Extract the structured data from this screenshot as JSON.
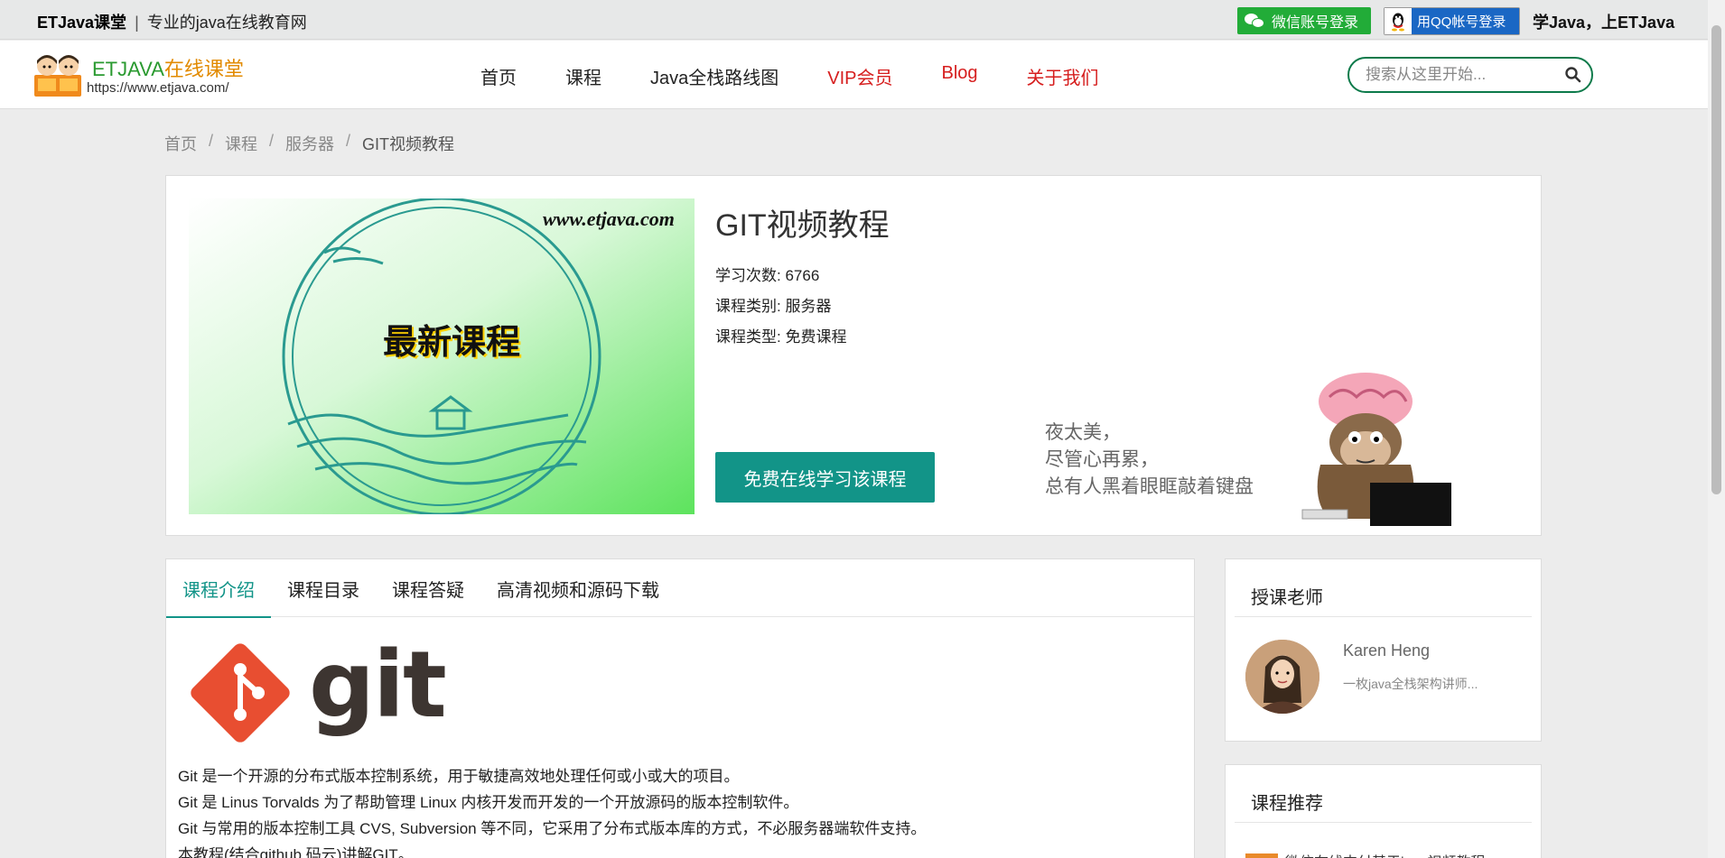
{
  "topbar": {
    "site_name": "ETJava课堂",
    "separator": "|",
    "tagline": "专业的java在线教育网",
    "wechat_login": "微信账号登录",
    "qq_login": "用QQ帐号登录",
    "slogan": "学Java，上ETJava"
  },
  "logo": {
    "brand_en": "ETJAVA",
    "brand_cn": "在线课堂",
    "url": "https://www.etjava.com/"
  },
  "nav": [
    {
      "label": "首页",
      "color": "#222222"
    },
    {
      "label": "课程",
      "color": "#222222"
    },
    {
      "label": "Java全栈路线图",
      "color": "#222222"
    },
    {
      "label": "VIP会员",
      "color": "#d61e1e"
    },
    {
      "label": "Blog",
      "color": "#d61e1e"
    },
    {
      "label": "关于我们",
      "color": "#d61e1e"
    }
  ],
  "search": {
    "placeholder": "搜索从这里开始..."
  },
  "breadcrumb": {
    "items": [
      "首页",
      "课程",
      "服务器"
    ],
    "current": "GIT视频教程",
    "divider": "/"
  },
  "course": {
    "cover_url_text": "www.etjava.com",
    "cover_badge": "最新课程",
    "title": "GIT视频教程",
    "study_count_label": "学习次数:",
    "study_count": "6766",
    "category_label": "课程类别:",
    "category": "服务器",
    "type_label": "课程类型:",
    "type": "免费课程",
    "study_button": "免费在线学习该课程",
    "poem_lines": [
      "夜太美，",
      "尽管心再累，",
      "总有人黑着眼眶敲着键盘"
    ]
  },
  "tabs": [
    {
      "label": "课程介绍",
      "active": true
    },
    {
      "label": "课程目录",
      "active": false
    },
    {
      "label": "课程答疑",
      "active": false
    },
    {
      "label": "高清视频和源码下载",
      "active": false
    }
  ],
  "intro": {
    "logo_text": "git",
    "paragraphs": [
      "Git 是一个开源的分布式版本控制系统，用于敏捷高效地处理任何或小或大的项目。",
      "Git 是 Linus Torvalds 为了帮助管理 Linux 内核开发而开发的一个开放源码的版本控制软件。",
      "Git 与常用的版本控制工具 CVS, Subversion 等不同，它采用了分布式版本库的方式，不必服务器端软件支持。",
      "本教程(结合github,码云)讲解GIT。"
    ]
  },
  "sidebar": {
    "teacher_title": "授课老师",
    "teacher_name": "Karen Heng",
    "teacher_desc": "一枚java全栈架构讲师...",
    "recommend_title": "课程推荐",
    "recommend_first": "微信在线支付基于java视频教程"
  },
  "colors": {
    "accent": "#129488",
    "brand_green": "#2a9a30",
    "nav_red": "#d61e1e",
    "wechat": "#22ac38",
    "qq": "#1a67c4"
  }
}
